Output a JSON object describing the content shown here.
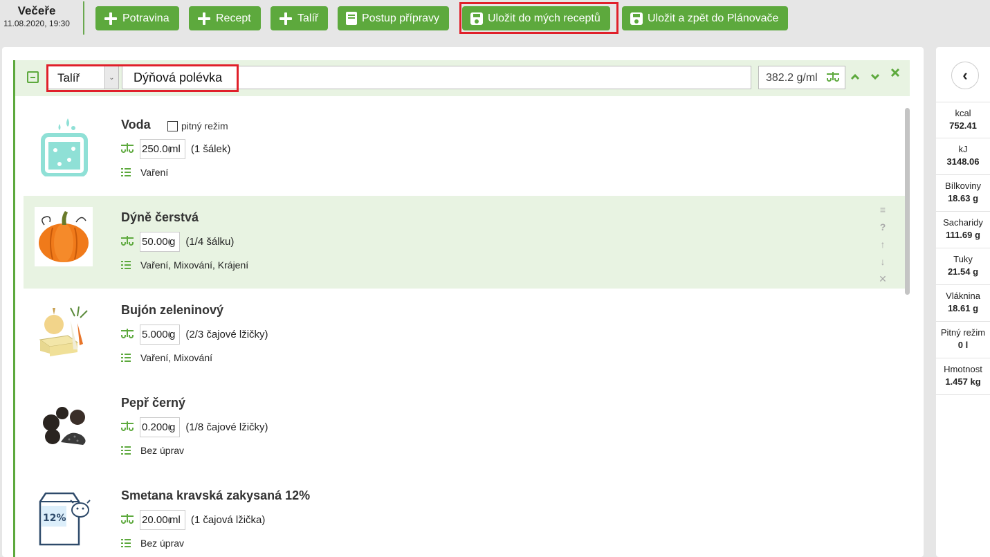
{
  "meal": {
    "title": "Večeře",
    "datetime": "11.08.2020, 19:30"
  },
  "toolbar": {
    "food_label": "Potravina",
    "recipe_label": "Recept",
    "plate_label": "Talíř",
    "procedure_label": "Postup přípravy",
    "save_recipe_label": "Uložit do mých receptů",
    "save_back_label": "Uložit a zpět do Plánovače"
  },
  "plate": {
    "type_value": "Talíř",
    "name": "Dýňová polévka",
    "density": "382.2 g/ml"
  },
  "foods": [
    {
      "name": "Voda",
      "drink_label": "pitný režim",
      "amount": "250.0(",
      "unit": "ml",
      "portion": "(1 šálek)",
      "prep": "Vaření"
    },
    {
      "name": "Dýně čerstvá",
      "amount": "50.00(",
      "unit": "g",
      "portion": "(1/4 šálku)",
      "prep": "Vaření, Mixování, Krájení"
    },
    {
      "name": "Bujón zeleninový",
      "amount": "5.000(",
      "unit": "g",
      "portion": "(2/3 čajové lžičky)",
      "prep": "Vaření, Mixování"
    },
    {
      "name": "Pepř černý",
      "amount": "0.200(",
      "unit": "g",
      "portion": "(1/8 čajové lžičky)",
      "prep": "Bez úprav"
    },
    {
      "name": "Smetana kravská zakysaná 12%",
      "amount": "20.00(",
      "unit": "ml",
      "portion": "(1 čajová lžička)",
      "prep": "Bez úprav",
      "image_text": "12%"
    }
  ],
  "nutrition": [
    {
      "label": "kcal",
      "value": "752.41"
    },
    {
      "label": "kJ",
      "value": "3148.06"
    },
    {
      "label": "Bílkoviny",
      "value": "18.63 g"
    },
    {
      "label": "Sacharidy",
      "value": "111.69 g"
    },
    {
      "label": "Tuky",
      "value": "21.54 g"
    },
    {
      "label": "Vláknina",
      "value": "18.61 g"
    },
    {
      "label": "Pitný režim",
      "value": "0 l"
    },
    {
      "label": "Hmotnost",
      "value": "1.457 kg"
    }
  ],
  "colors": {
    "accent": "#5da93d",
    "highlight": "#e0202a",
    "active_row": "#e8f3e2"
  }
}
